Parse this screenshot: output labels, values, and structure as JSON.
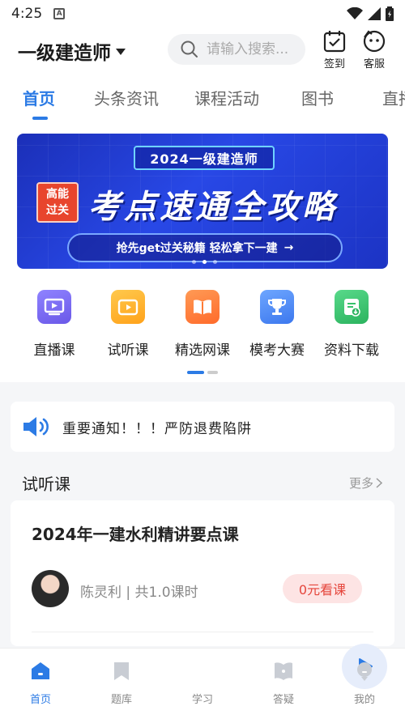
{
  "status": {
    "time": "4:25",
    "app_icon_letter": "A"
  },
  "header": {
    "title": "一级建造师",
    "search_placeholder": "请输入搜索...",
    "checkin_label": "签到",
    "service_label": "客服"
  },
  "tabs": [
    {
      "label": "首页"
    },
    {
      "label": "头条资讯"
    },
    {
      "label": "课程活动"
    },
    {
      "label": "图书"
    },
    {
      "label": "直播"
    }
  ],
  "banner": {
    "year_pill": "2024一级建造师",
    "badge_line1": "高能",
    "badge_line2": "过关",
    "headline": "考点速通全攻略",
    "cta": "抢先get过关秘籍  轻松拿下一建",
    "cta_arrow": "→"
  },
  "quick_links": [
    {
      "label": "直播课",
      "icon": "live-tv-icon",
      "color": "#7b6cf0"
    },
    {
      "label": "试听课",
      "icon": "video-play-icon",
      "color": "#ffb22e"
    },
    {
      "label": "精选网课",
      "icon": "book-open-icon",
      "color": "#ff7a35"
    },
    {
      "label": "模考大赛",
      "icon": "trophy-icon",
      "color": "#4f8df5"
    },
    {
      "label": "资料下载",
      "icon": "download-icon",
      "color": "#37c26b"
    }
  ],
  "notice": {
    "text": "重要通知！！！严防退费陷阱",
    "icon": "speaker-icon"
  },
  "trial_section": {
    "title": "试听课",
    "more": "更多"
  },
  "course": {
    "title": "2024年一建水利精讲要点课",
    "teacher_meta": "陈灵利 | 共1.0课时",
    "button": "0元看课"
  },
  "bottom_nav": [
    {
      "label": "首页",
      "icon": "home-icon",
      "active": true
    },
    {
      "label": "题库",
      "icon": "bookmark-icon",
      "active": false
    },
    {
      "label": "学习",
      "icon": "play-icon",
      "active": false
    },
    {
      "label": "答疑",
      "icon": "question-book-icon",
      "active": false
    },
    {
      "label": "我的",
      "icon": "profile-icon",
      "active": false
    }
  ],
  "colors": {
    "accent": "#2c7be5",
    "price": "#e5453b",
    "banner": "#2848e6"
  }
}
